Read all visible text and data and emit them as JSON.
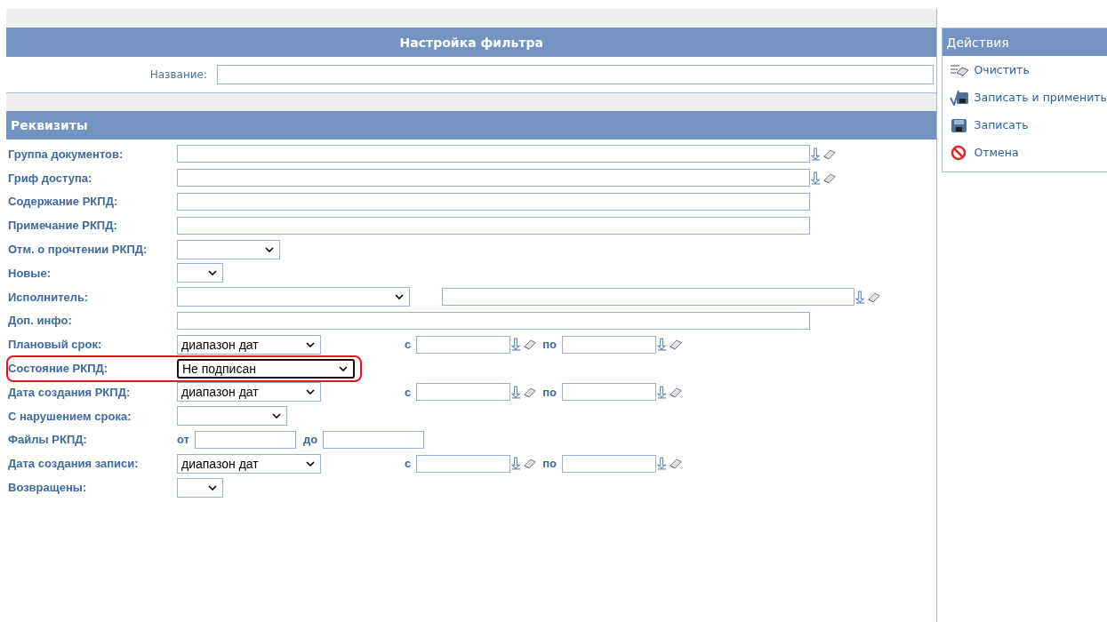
{
  "filter_header": {
    "title": "Настройка фильтра"
  },
  "name_field": {
    "label": "Название:"
  },
  "section": {
    "title": "Реквизиты"
  },
  "rows": [
    {
      "kind": "text",
      "label": "Группа документов:",
      "pick": true
    },
    {
      "kind": "text",
      "label": "Гриф доступа:",
      "pick": true
    },
    {
      "kind": "text",
      "label": "Содержание РКПД:",
      "pick": false
    },
    {
      "kind": "text",
      "label": "Примечание РКПД:",
      "pick": false
    },
    {
      "kind": "select",
      "label": "Отм. о прочтении РКПД:",
      "highlighted": false
    },
    {
      "kind": "select",
      "label": "Новые:",
      "highlighted": false
    },
    {
      "kind": "select_text",
      "label": "Исполнитель:",
      "pick": true
    },
    {
      "kind": "text",
      "label": "Доп. инфо:",
      "pick": false
    },
    {
      "kind": "daterange",
      "label": "Плановый срок:",
      "value": "диапазон дат",
      "from_label": "с",
      "to_label": "по"
    },
    {
      "kind": "select",
      "label": "Состояние РКПД:",
      "value": "Не подписан",
      "highlighted": true
    },
    {
      "kind": "daterange",
      "label": "Дата создания РКПД:",
      "value": "диапазон дат",
      "from_label": "с",
      "to_label": "по"
    },
    {
      "kind": "select",
      "label": "С нарушением срока:",
      "highlighted": false
    },
    {
      "kind": "files",
      "label": "Файлы РКПД:",
      "from_label": "от",
      "to_label": "до"
    },
    {
      "kind": "daterange",
      "label": "Дата создания записи:",
      "value": "диапазон дат",
      "from_label": "с",
      "to_label": "по"
    },
    {
      "kind": "select",
      "label": "Возвращены:",
      "highlighted": false
    }
  ],
  "actions": {
    "title": "Действия",
    "items": [
      {
        "kind": "clear",
        "label": "Очистить"
      },
      {
        "kind": "save_apply",
        "label": "Записать и применить"
      },
      {
        "kind": "save",
        "label": "Записать"
      },
      {
        "kind": "cancel",
        "label": "Отмена"
      }
    ]
  }
}
